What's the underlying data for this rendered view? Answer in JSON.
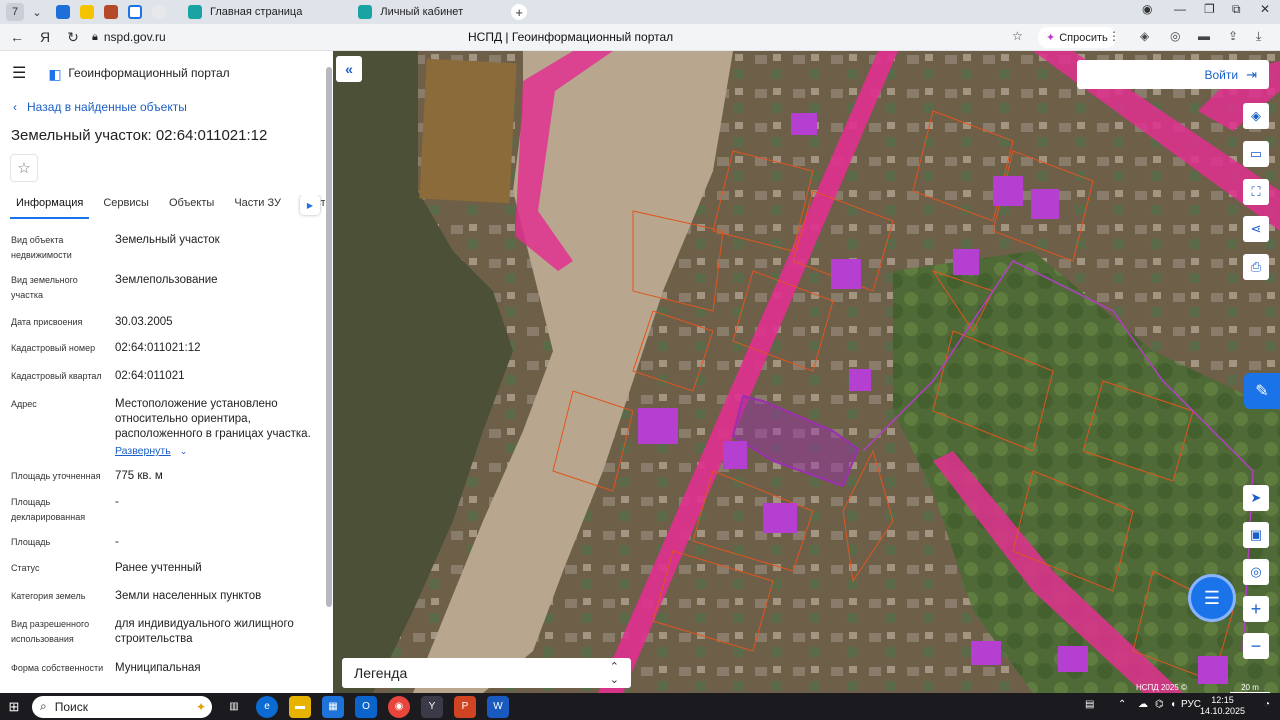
{
  "browser": {
    "tab_count": "7",
    "tabs": [
      {
        "label": "Главная страница"
      },
      {
        "label": "Личный кабинет"
      }
    ],
    "url": "nspd.gov.ru",
    "page_title": "НСПД | Геоинформационный портал",
    "ask_label": "Спросить"
  },
  "header": {
    "portal_title": "Геоинформационный портал"
  },
  "panel": {
    "back_label": "Назад в найденные объекты",
    "object_title": "Земельный участок: 02:64:011021:12",
    "tabs": [
      {
        "label": "Информация",
        "active": true
      },
      {
        "label": "Сервисы"
      },
      {
        "label": "Объекты"
      },
      {
        "label": "Части ЗУ"
      },
      {
        "label": "Соста"
      }
    ],
    "props": [
      {
        "key": "Вид объекта недвижимости",
        "value": "Земельный участок"
      },
      {
        "key": "Вид земельного участка",
        "value": "Землепользование"
      },
      {
        "key": "Дата присвоения",
        "value": "30.03.2005"
      },
      {
        "key": "Кадастровый номер",
        "value": "02:64:011021:12"
      },
      {
        "key": "Кадастровый квартал",
        "value": "02:64:011021"
      },
      {
        "key": "Адрес",
        "value": "Местоположение установлено относительно ориентира, расположенного в границах участка."
      },
      {
        "key": "Площадь уточненная",
        "value": "775 кв. м"
      },
      {
        "key": "Площадь декларированная",
        "value": "-"
      },
      {
        "key": "Площадь",
        "value": "-"
      },
      {
        "key": "Статус",
        "value": "Ранее учтенный"
      },
      {
        "key": "Категория земель",
        "value": "Земли населенных пунктов"
      },
      {
        "key": "Вид разрешенного использования",
        "value": "для индивидуального жилищного строительства"
      },
      {
        "key": "Форма собственности",
        "value": "Муниципальная"
      }
    ],
    "expand_label": "Развернуть"
  },
  "map": {
    "login_label": "Войти",
    "legend_label": "Легенда",
    "attribution": "НСПД 2025 ©",
    "scale_label": "20 m",
    "colors": {
      "zone": "#e0308f",
      "parcel_line": "#e0551f",
      "selected": "#9b2fb0",
      "accent": "#1a73e8"
    }
  },
  "taskbar": {
    "search_label": "Поиск",
    "language": "РУС",
    "time": "12:15",
    "date": "14.10.2025"
  }
}
